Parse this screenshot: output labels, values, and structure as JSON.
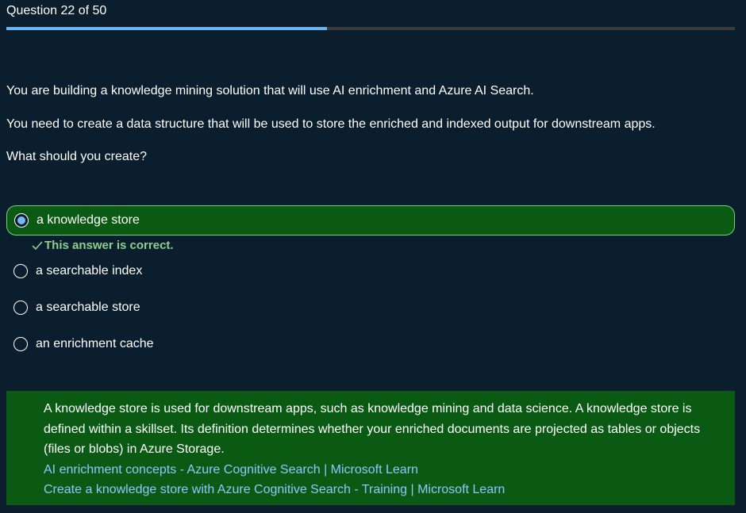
{
  "header": {
    "question_label": "Question 22 of 50",
    "progress_fraction": 0.44
  },
  "question": {
    "lines": [
      "You are building a knowledge mining solution that will use AI enrichment and Azure AI Search.",
      "You need to create a data structure that will be used to store the enriched and indexed output for downstream apps.",
      "What should you create?"
    ]
  },
  "options": [
    {
      "label": "a knowledge store",
      "selected": true
    },
    {
      "label": "a searchable index",
      "selected": false
    },
    {
      "label": "a searchable store",
      "selected": false
    },
    {
      "label": "an enrichment cache",
      "selected": false
    }
  ],
  "feedback": {
    "text": "This answer is correct.",
    "icon": "checkmark-icon"
  },
  "explanation": {
    "text": "A knowledge store is used for downstream apps, such as knowledge mining and data science. A knowledge store is defined within a skillset. Its definition determines whether your enriched documents are projected as tables or objects (files or blobs) in Azure Storage.",
    "links": [
      "AI enrichment concepts - Azure Cognitive Search | Microsoft Learn",
      "Create a knowledge store with Azure Cognitive Search - Training | Microsoft Learn"
    ]
  },
  "colors": {
    "background": "#0b1e2d",
    "progress_fill": "#6cb4ee",
    "progress_track": "#3b3b3b",
    "correct_bg": "#0b5a14",
    "correct_border": "#7fce7f",
    "correct_text": "#8fce8f",
    "link": "#8cc8ff",
    "radio_dot": "#7ab8f0"
  }
}
